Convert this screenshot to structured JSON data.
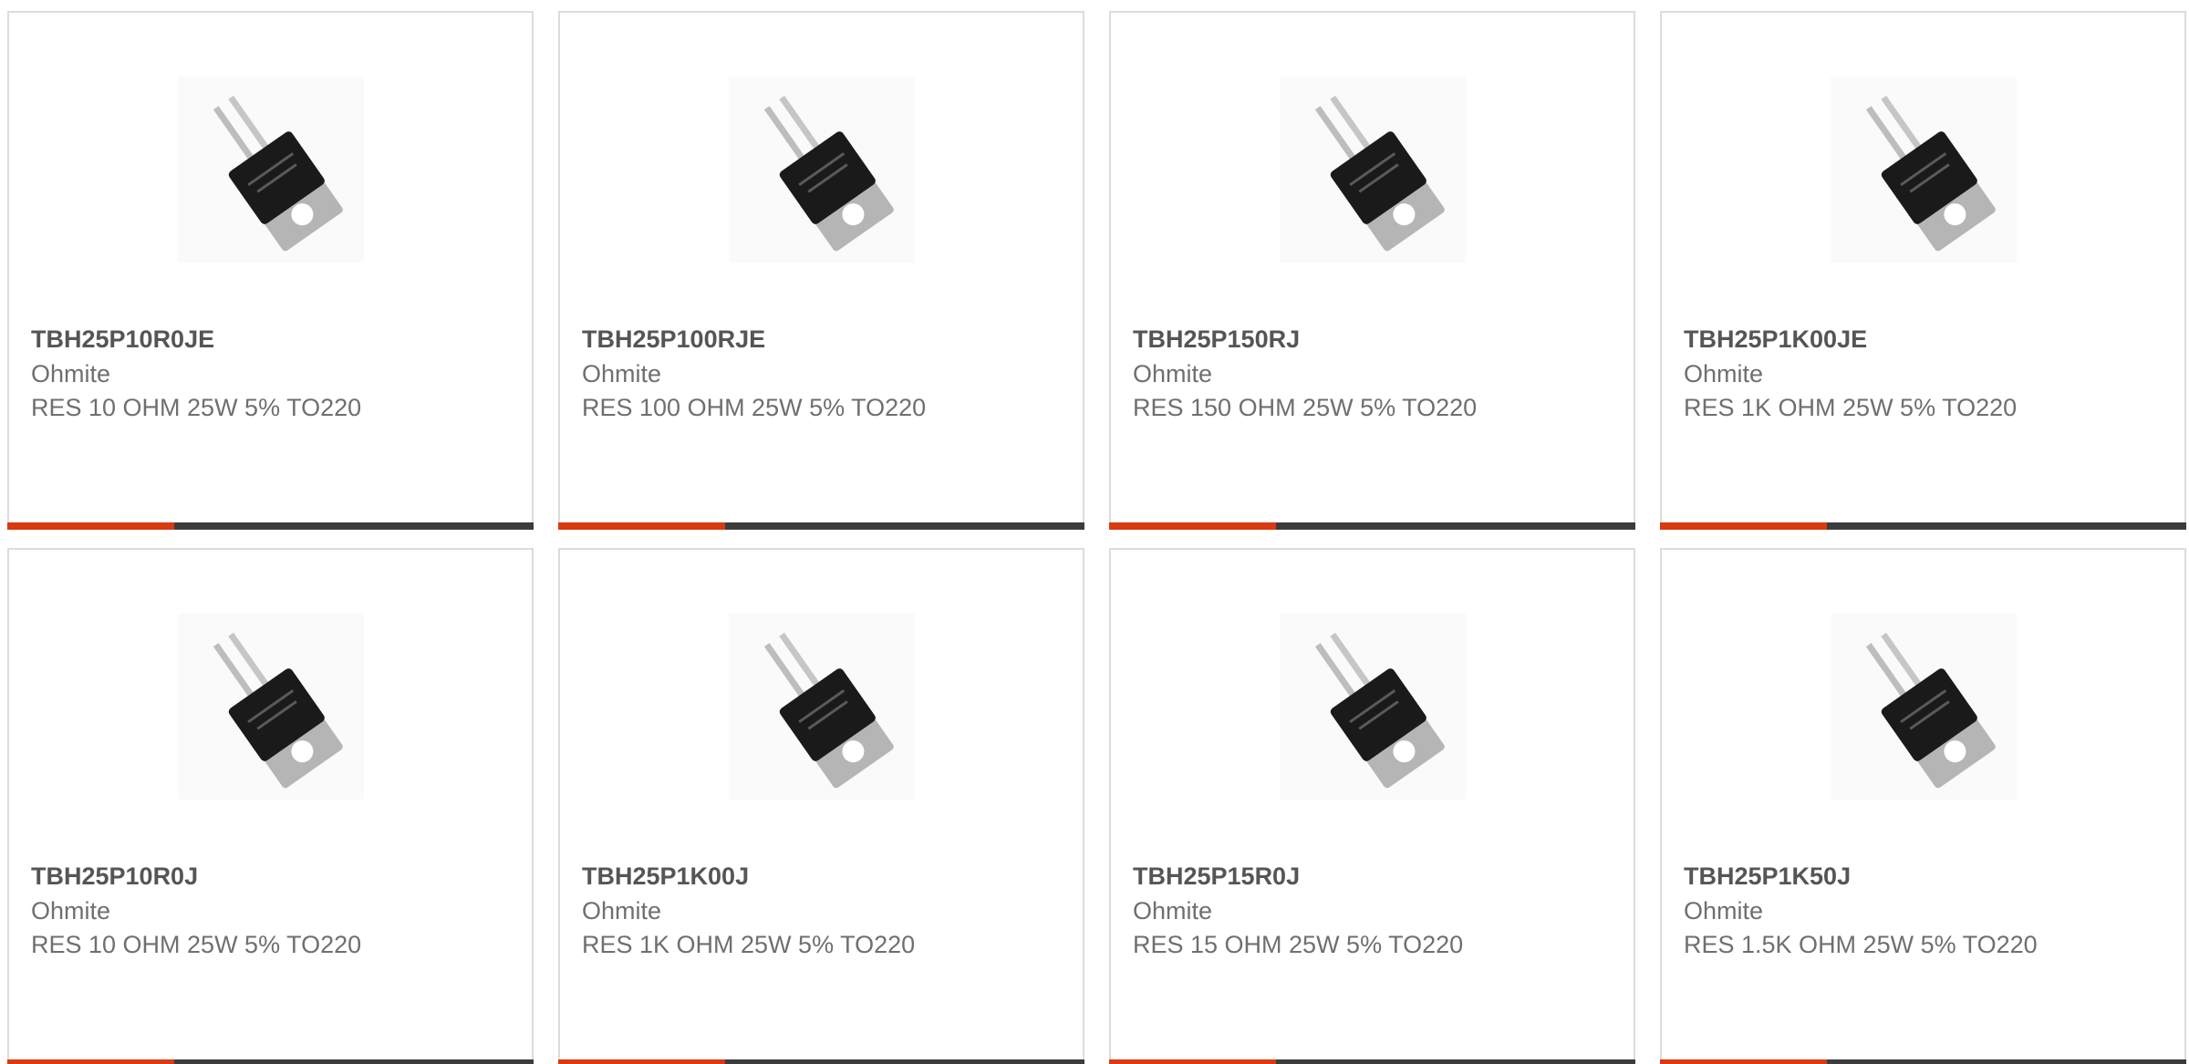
{
  "accent_color": "#d93a11",
  "bar_color": "#3c3c3c",
  "products": [
    {
      "part": "TBH25P10R0JE",
      "maker": "Ohmite",
      "desc": "RES 10 OHM 25W 5% TO220",
      "image_icon": "to220-resistor-icon"
    },
    {
      "part": "TBH25P100RJE",
      "maker": "Ohmite",
      "desc": "RES 100 OHM 25W 5% TO220",
      "image_icon": "to220-resistor-icon"
    },
    {
      "part": "TBH25P150RJ",
      "maker": "Ohmite",
      "desc": "RES 150 OHM 25W 5% TO220",
      "image_icon": "to220-resistor-icon"
    },
    {
      "part": "TBH25P1K00JE",
      "maker": "Ohmite",
      "desc": "RES 1K OHM 25W 5% TO220",
      "image_icon": "to220-resistor-icon"
    },
    {
      "part": "TBH25P10R0J",
      "maker": "Ohmite",
      "desc": "RES 10 OHM 25W 5% TO220",
      "image_icon": "to220-resistor-icon"
    },
    {
      "part": "TBH25P1K00J",
      "maker": "Ohmite",
      "desc": "RES 1K OHM 25W 5% TO220",
      "image_icon": "to220-resistor-icon"
    },
    {
      "part": "TBH25P15R0J",
      "maker": "Ohmite",
      "desc": "RES 15 OHM 25W 5% TO220",
      "image_icon": "to220-resistor-icon"
    },
    {
      "part": "TBH25P1K50J",
      "maker": "Ohmite",
      "desc": "RES 1.5K OHM 25W 5% TO220",
      "image_icon": "to220-resistor-icon"
    }
  ]
}
